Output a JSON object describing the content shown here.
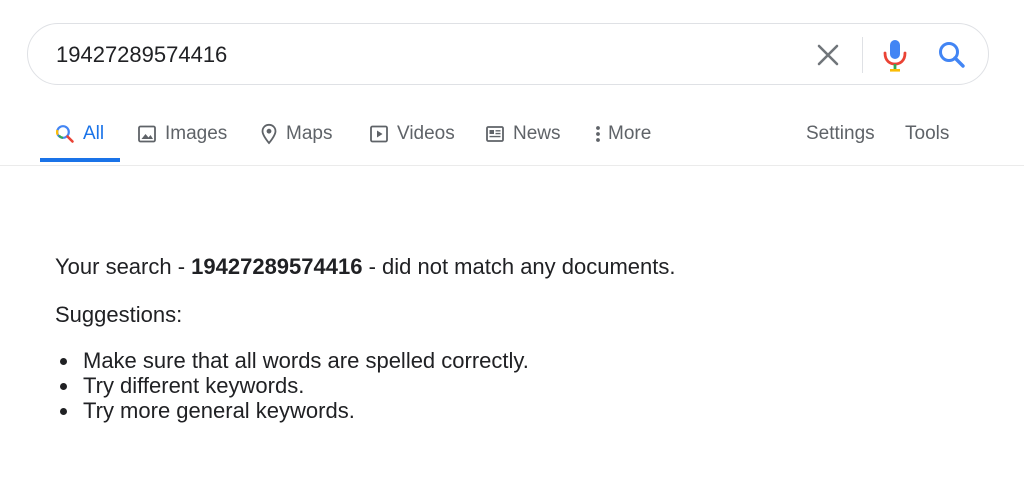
{
  "search": {
    "query": "19427289574416"
  },
  "tabs": [
    {
      "label": "All",
      "icon": "search-icon",
      "active": true
    },
    {
      "label": "Images",
      "icon": "image-icon"
    },
    {
      "label": "Maps",
      "icon": "map-pin-icon"
    },
    {
      "label": "Videos",
      "icon": "play-icon"
    },
    {
      "label": "News",
      "icon": "news-icon"
    },
    {
      "label": "More",
      "icon": "more-vert-icon"
    }
  ],
  "tools": {
    "settings_label": "Settings",
    "tools_label": "Tools"
  },
  "results": {
    "message_prefix": "Your search - ",
    "query": "19427289574416",
    "message_suffix": " - did not match any documents.",
    "suggestions_title": "Suggestions:",
    "suggestions": [
      "Make sure that all words are spelled correctly.",
      "Try different keywords.",
      "Try more general keywords."
    ]
  },
  "colors": {
    "accent": "#1a73e8",
    "text": "#202124",
    "muted": "#5f6368",
    "border": "#dfe1e5"
  }
}
